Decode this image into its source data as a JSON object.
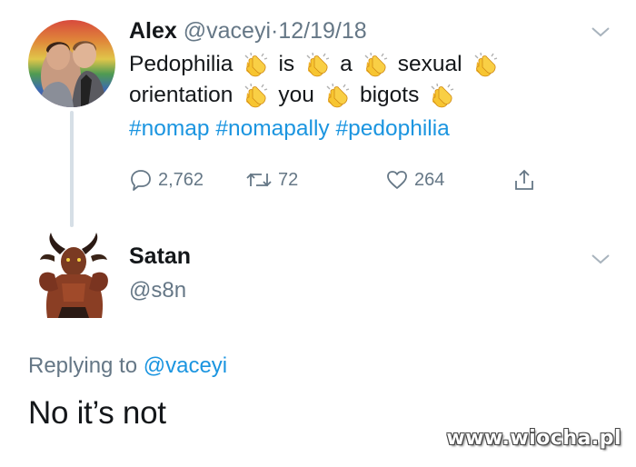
{
  "tweet": {
    "author_name": "Alex",
    "author_handle": "@vaceyi",
    "separator": "·",
    "date": "12/19/18",
    "line1": [
      "Pedophilia",
      "is",
      "a",
      "sexual"
    ],
    "line2": [
      "orientation",
      "you",
      "bigots"
    ],
    "hashtags": "#nomap #nomapally #pedophilia",
    "clap_icon": "clapping-hands-emoji",
    "actions": {
      "reply_count": "2,762",
      "retweet_count": "72",
      "like_count": "264",
      "reply_icon": "reply-icon",
      "retweet_icon": "retweet-icon",
      "like_icon": "heart-icon",
      "share_icon": "share-icon"
    },
    "menu_icon": "chevron-down-icon"
  },
  "reply": {
    "author_name": "Satan",
    "author_handle": "@s8n",
    "replying_prefix": "Replying to",
    "replying_handle": "@vaceyi",
    "text": "No it’s not",
    "menu_icon": "chevron-down-icon"
  },
  "watermark": "www.wiocha.pl",
  "colors": {
    "text": "#14171a",
    "secondary": "#657786",
    "link": "#1b95e0",
    "thread_line": "#d6dfe6",
    "clap_yellow": "#f7c531"
  }
}
